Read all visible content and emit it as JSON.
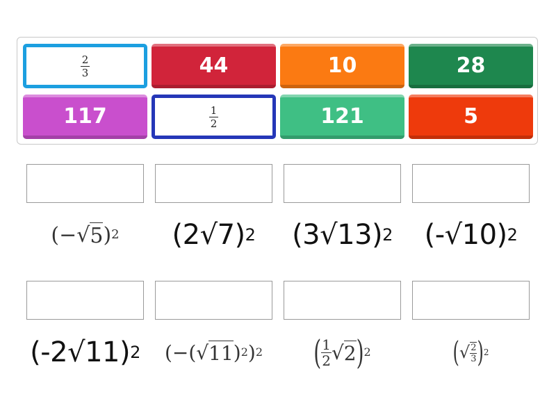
{
  "tiles": [
    {
      "label": "",
      "num": "2",
      "den": "3",
      "kind": "fraction",
      "color": "#1c9fe0"
    },
    {
      "label": "44",
      "kind": "number",
      "color": "#d1243a"
    },
    {
      "label": "10",
      "kind": "number",
      "color": "#fb7a12"
    },
    {
      "label": "28",
      "kind": "number",
      "color": "#1e874e"
    },
    {
      "label": "117",
      "kind": "number",
      "color": "#c94fcd"
    },
    {
      "label": "",
      "num": "1",
      "den": "2",
      "kind": "fraction",
      "color": "#2537b8"
    },
    {
      "label": "121",
      "kind": "number",
      "color": "#3fbf84"
    },
    {
      "label": "5",
      "kind": "number",
      "color": "#ee3a0c"
    }
  ],
  "expressions": {
    "e1": {
      "open": "(",
      "sign": "−",
      "rad": "√",
      "radicand": "5",
      "close": ")",
      "exp": "2"
    },
    "e2": {
      "text": "(2√7)",
      "exp": "2"
    },
    "e3": {
      "text": "(3√13)",
      "exp": "2"
    },
    "e4": {
      "text": "(-√10)",
      "exp": "2"
    },
    "e5": {
      "text": "(-2√11)",
      "exp": "2"
    },
    "e6": {
      "open": "(",
      "sign": "−",
      "inner_open": "(",
      "rad": "√",
      "radicand": "11",
      "inner_close": ")",
      "inner_exp": "2",
      "close": ")",
      "exp": "2"
    },
    "e7": {
      "open": "(",
      "num": "1",
      "den": "2",
      "rad": "√",
      "radicand": "2",
      "close": ")",
      "exp": "2"
    },
    "e8": {
      "open": "(",
      "rad": "√",
      "num": "2",
      "den": "3",
      "close": ")",
      "exp": "2"
    }
  }
}
